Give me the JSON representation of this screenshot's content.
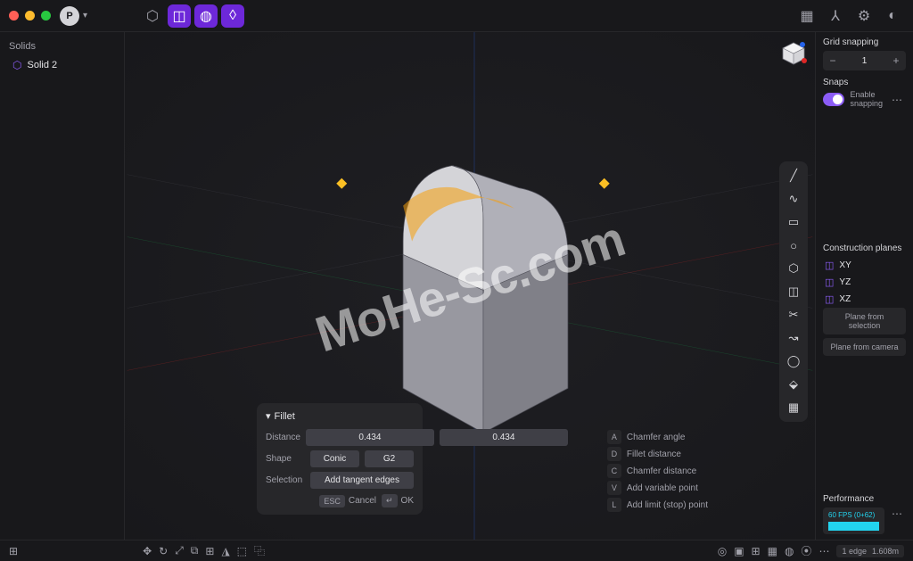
{
  "topbar": {
    "avatar_initial": "P"
  },
  "outline": {
    "title": "Solids",
    "items": [
      {
        "label": "Solid 2"
      }
    ]
  },
  "right": {
    "grid_snapping": "Grid snapping",
    "grid_value": "1",
    "snaps": "Snaps",
    "enable_snapping": "Enable snapping",
    "construction_planes": "Construction planes",
    "planes": [
      "XY",
      "YZ",
      "XZ"
    ],
    "plane_from_selection": "Plane from selection",
    "plane_from_camera": "Plane from camera",
    "performance": "Performance",
    "perf_label": "60 FPS (0+62)"
  },
  "fillet": {
    "title": "Fillet",
    "distance_label": "Distance",
    "distance1": "0.434",
    "distance2": "0.434",
    "shape_label": "Shape",
    "shape1": "Conic",
    "shape2": "G2",
    "selection_label": "Selection",
    "selection_btn": "Add tangent edges",
    "esc": "ESC",
    "cancel": "Cancel",
    "ok": "OK",
    "enter": "↵"
  },
  "shortcuts": [
    {
      "key": "A",
      "label": "Chamfer angle"
    },
    {
      "key": "D",
      "label": "Fillet distance"
    },
    {
      "key": "C",
      "label": "Chamfer distance"
    },
    {
      "key": "V",
      "label": "Add variable point"
    },
    {
      "key": "L",
      "label": "Add limit (stop) point"
    }
  ],
  "status": {
    "edges": "1 edge",
    "dim": "1.608m"
  },
  "watermark": "MoHe-Sc.com"
}
